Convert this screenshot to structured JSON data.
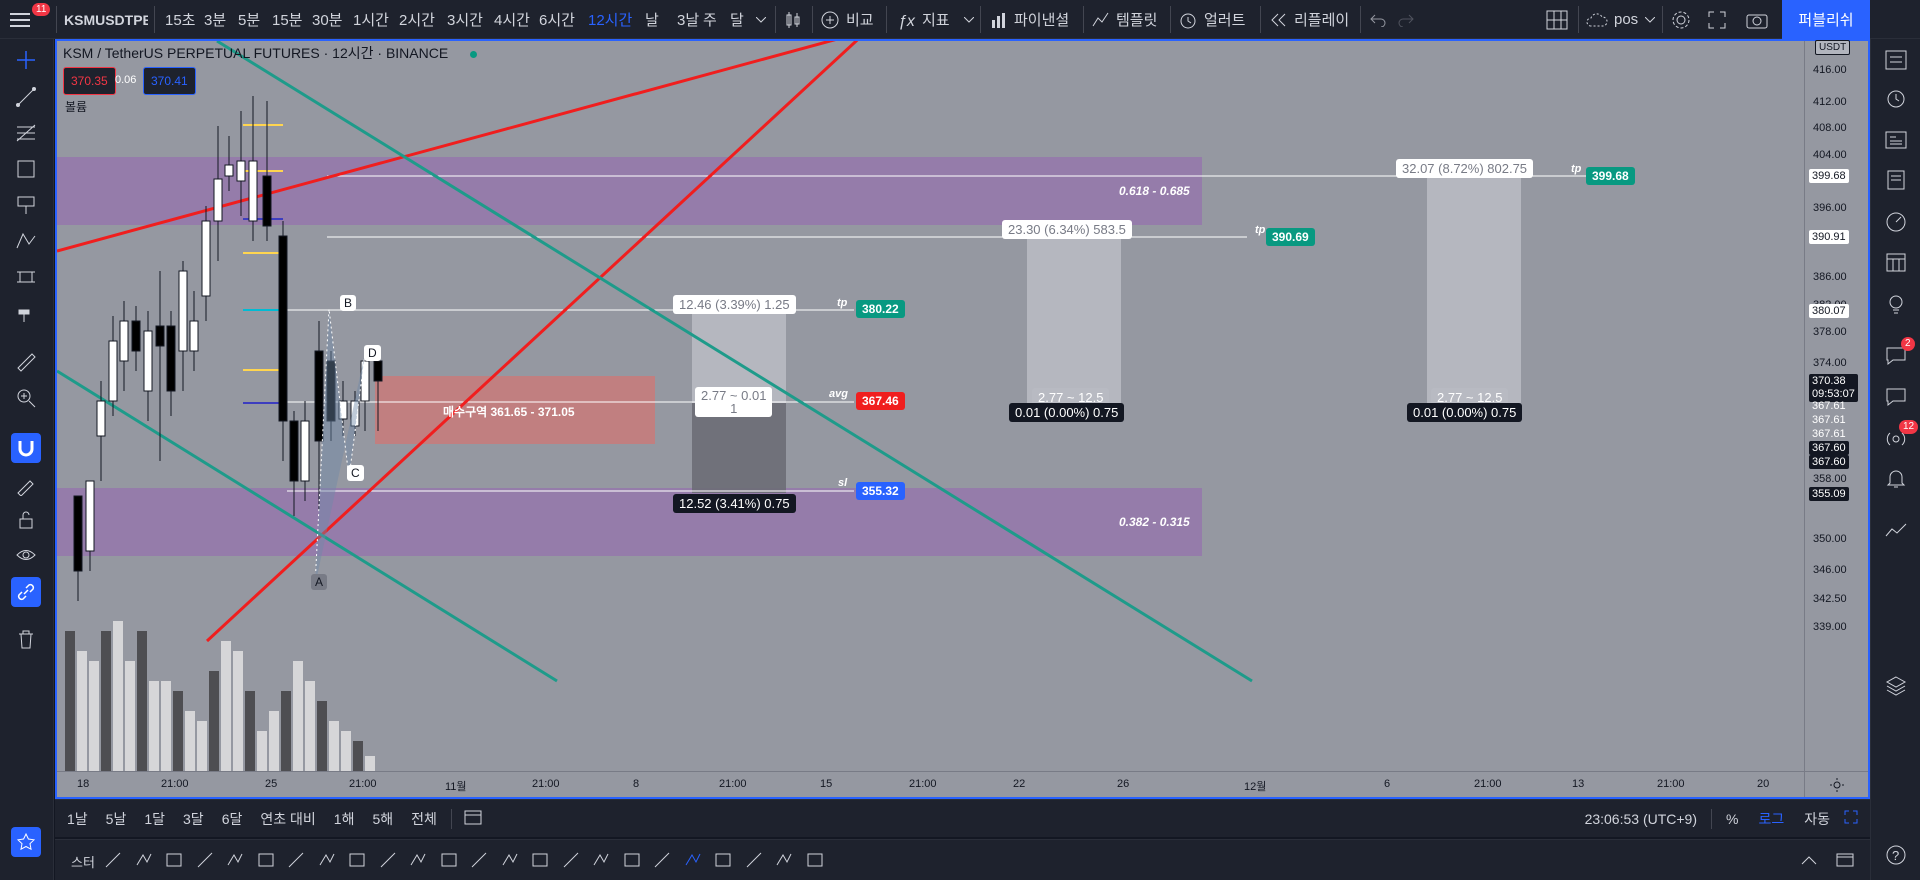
{
  "topbar": {
    "notif_count": "11",
    "symbol": "KSMUSDTPER",
    "intervals": [
      "15초",
      "3분",
      "5분",
      "15분",
      "30분",
      "1시간",
      "2시간",
      "3시간",
      "4시간",
      "6시간",
      "12시간",
      "날",
      "3날",
      "주",
      "달"
    ],
    "active_interval": "12시간",
    "compare": "비교",
    "indicators": "지표",
    "financials": "파이낸셜",
    "templates": "템플릿",
    "alert": "얼러트",
    "replay": "리플레이",
    "layout_name": "pos",
    "publish": "퍼블리쉬",
    "accent": "#2962ff"
  },
  "legend": {
    "title": "KSM / TetherUS PERPETUAL FUTURES · 12시간 · BINANCE",
    "sell_price": "370.35",
    "spread": "0.06",
    "buy_price": "370.41",
    "volume_label": "볼륨"
  },
  "zones": {
    "fib_upper": "0.618 - 0.685",
    "fib_lower": "0.382 - 0.315",
    "buy_zone": "매수구역 361.65 - 371.05"
  },
  "positions": [
    {
      "top_label": "12.46 (3.39%) 1.25",
      "mid_label1": "2.77 ~ 0.01",
      "mid_label2": "1",
      "bottom_label": "12.52 (3.41%) 0.75",
      "tp_tag": "tp",
      "tp_price": "380.22",
      "avg_tag": "avg",
      "avg_price": "367.46",
      "sl_tag": "sl",
      "sl_price": "355.32"
    },
    {
      "top_label": "23.30 (6.34%) 583.5",
      "mid_label": "2.77 ~ 12.5",
      "bottom_label": "0.01 (0.00%) 0.75",
      "tp_tag": "tp",
      "tp_price": "390.69"
    },
    {
      "top_label": "32.07 (8.72%) 802.75",
      "mid_label": "2.77 ~ 12.5",
      "bottom_label": "0.01 (0.00%) 0.75",
      "tp_tag": "tp",
      "tp_price": "399.68"
    }
  ],
  "pattern": [
    "A",
    "B",
    "C",
    "D"
  ],
  "yaxis": {
    "currency": "USDT",
    "ticks": [
      "416.00",
      "412.00",
      "408.00",
      "404.00",
      "396.00",
      "386.00",
      "382.00",
      "378.00",
      "374.00",
      "358.00",
      "350.00",
      "346.00",
      "342.50",
      "339.00"
    ],
    "labels": {
      "l39968": "399.68",
      "l39091": "390.91",
      "l38007": "380.07",
      "price": "370.38",
      "countdown": "09:53:07",
      "l1": "367.61",
      "l2": "367.61",
      "l3": "367.61",
      "l4": "367.60",
      "l5": "367.60",
      "l35509": "355.09"
    }
  },
  "xaxis": {
    "ticks": [
      "18",
      "21:00",
      "25",
      "21:00",
      "11월",
      "21:00",
      "8",
      "21:00",
      "15",
      "21:00",
      "22",
      "26",
      "12월",
      "6",
      "21:00",
      "13",
      "21:00",
      "20"
    ]
  },
  "bottombar": {
    "ranges": [
      "1날",
      "5날",
      "1달",
      "3달",
      "6달",
      "연초 대비",
      "1해",
      "5해",
      "전체"
    ],
    "clock": "23:06:53 (UTC+9)",
    "percent": "%",
    "log": "로그",
    "auto": "자동"
  },
  "rightbar": {
    "chat_badge": "2",
    "signals_badge": "12"
  },
  "drawbar": {
    "first_label": "스터"
  }
}
